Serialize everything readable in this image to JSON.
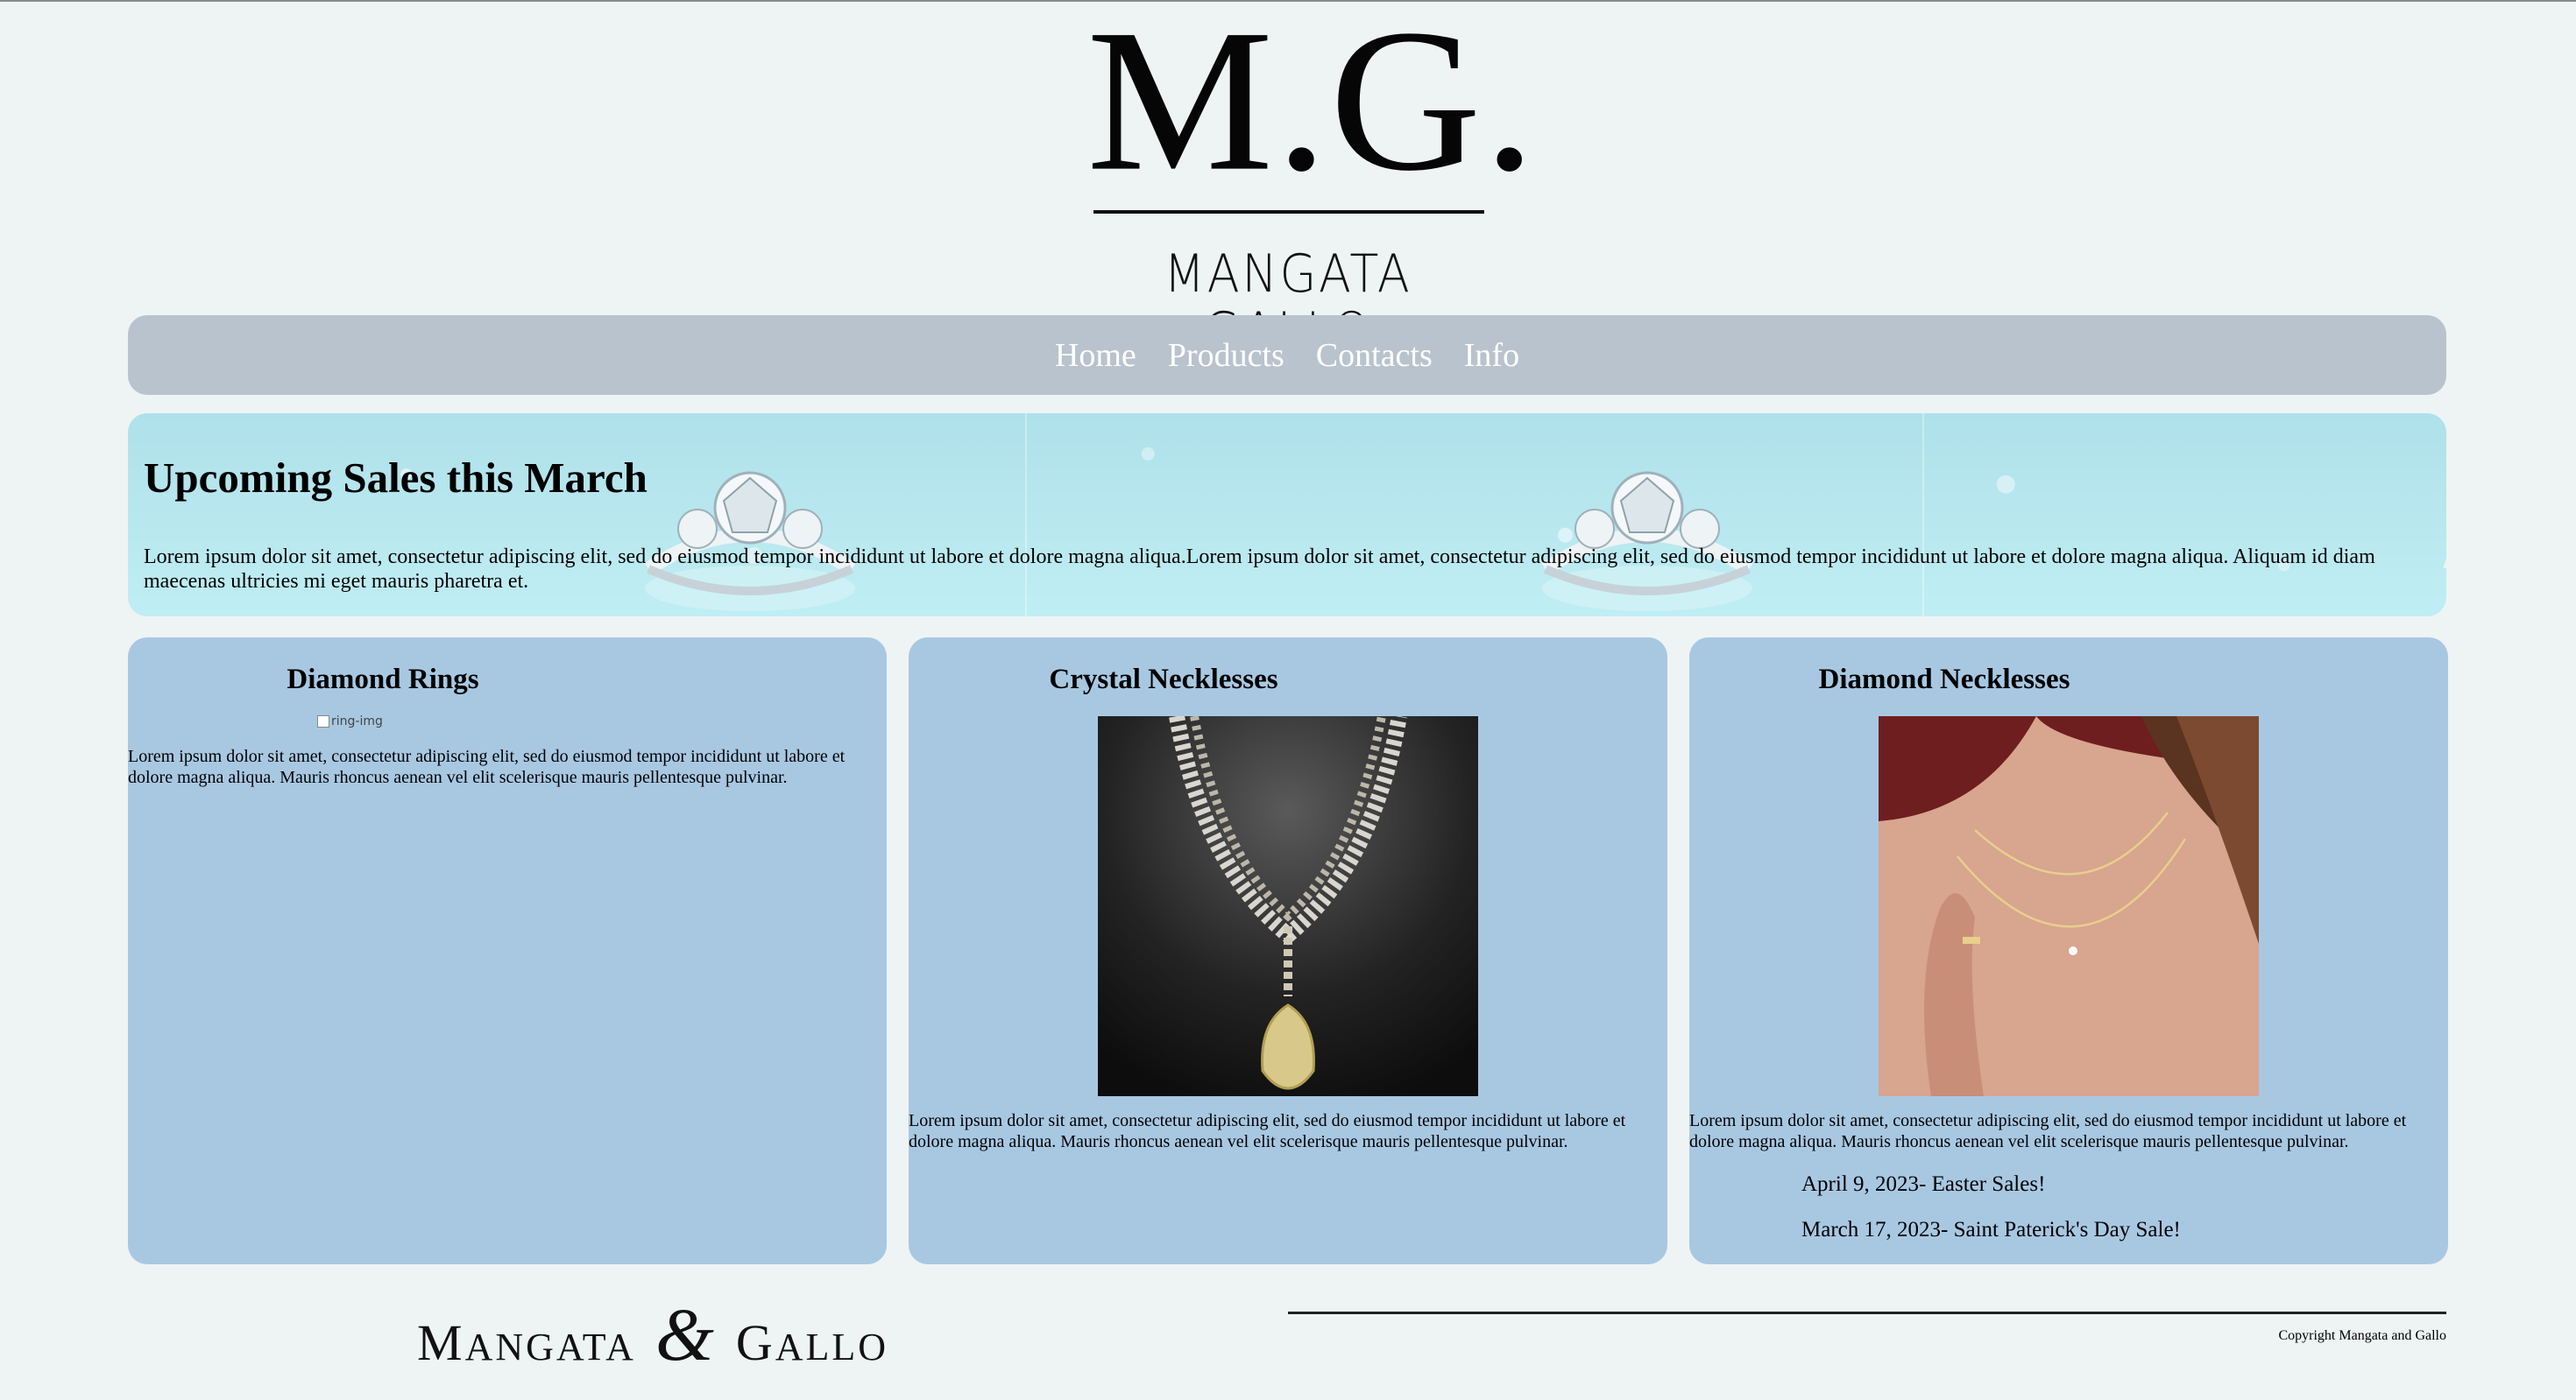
{
  "brand": {
    "monogram": "M.G.",
    "name": "MANGATA GALLO",
    "footer_logo_first": "M",
    "footer_logo_first_rest": "ANGATA",
    "footer_logo_amp": "&",
    "footer_logo_second": "G",
    "footer_logo_second_rest": "ALLO"
  },
  "nav": {
    "items": [
      {
        "label": "Home"
      },
      {
        "label": "Products"
      },
      {
        "label": "Contacts"
      },
      {
        "label": "Info"
      }
    ]
  },
  "banner": {
    "title": "Upcoming Sales this March",
    "text": "Lorem ipsum dolor sit amet, consectetur adipiscing elit, sed do eiusmod tempor incididunt ut labore et dolore magna aliqua.Lorem ipsum dolor sit amet, consectetur adipiscing elit, sed do eiusmod tempor incididunt ut labore et dolore magna aliqua. Aliquam id diam maecenas ultricies mi eget mauris pharetra et."
  },
  "cards": [
    {
      "title": "Diamond Rings",
      "img_alt": "ring-img",
      "text": "Lorem ipsum dolor sit amet, consectetur adipiscing elit, sed do eiusmod tempor incididunt ut labore et dolore magna aliqua. Mauris rhoncus aenean vel elit scelerisque mauris pellentesque pulvinar."
    },
    {
      "title": "Crystal Necklesses",
      "text": "Lorem ipsum dolor sit amet, consectetur adipiscing elit, sed do eiusmod tempor incididunt ut labore et dolore magna aliqua. Mauris rhoncus aenean vel elit scelerisque mauris pellentesque pulvinar."
    },
    {
      "title": "Diamond Necklesses",
      "text": "Lorem ipsum dolor sit amet, consectetur adipiscing elit, sed do eiusmod tempor incididunt ut labore et dolore magna aliqua. Mauris rhoncus aenean vel elit scelerisque mauris pellentesque pulvinar.",
      "sales": [
        "April 9, 2023- Easter Sales!",
        "March 17, 2023- Saint Paterick's Day Sale!"
      ]
    }
  ],
  "footer": {
    "copyright": "Copyright Mangata and Gallo"
  },
  "colors": {
    "page_bg": "#eef4f4",
    "nav_bg": "#b8c3cd",
    "card_bg": "#a8c8e2",
    "banner_bg": "#b7e6ee"
  }
}
